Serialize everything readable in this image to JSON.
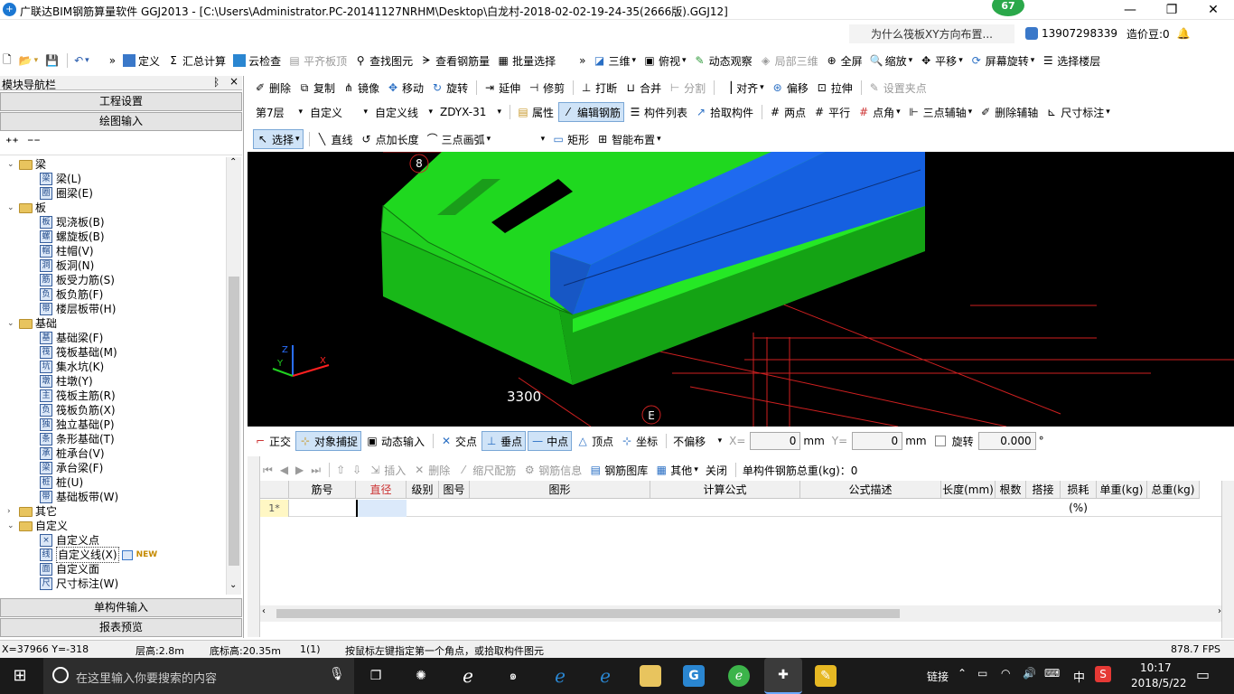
{
  "window": {
    "title": "广联达BIM钢筋算量软件 GGJ2013 - [C:\\Users\\Administrator.PC-20141127NRHM\\Desktop\\白龙村-2018-02-02-19-24-35(2666版).GGJ12]",
    "badge": "67",
    "min": "—",
    "max": "❐",
    "close": "✕"
  },
  "menu_right": {
    "question": "为什么筏板XY方向布置...",
    "phone": "13907298339",
    "coins": "造价豆:0"
  },
  "toolbar1": {
    "items": [
      "定义",
      "汇总计算",
      "云检查",
      "平齐板顶",
      "查找图元",
      "查看钢筋量",
      "批量选择",
      "三维",
      "俯视",
      "动态观察",
      "局部三维",
      "全屏",
      "缩放",
      "平移",
      "屏幕旋转",
      "选择楼层"
    ]
  },
  "panel": {
    "title": "模块导航栏",
    "pin": "ᛒ",
    "close": "×",
    "btn_project": "工程设置",
    "btn_drawing": "绘图输入",
    "btn_single": "单构件输入",
    "btn_report": "报表预览"
  },
  "tree": [
    {
      "type": "folder",
      "label": "梁",
      "toggle": "⌄"
    },
    {
      "type": "leaf",
      "label": "梁(L)",
      "icon": "梁"
    },
    {
      "type": "leaf",
      "label": "圈梁(E)",
      "icon": "圈"
    },
    {
      "type": "folder",
      "label": "板",
      "toggle": "⌄"
    },
    {
      "type": "leaf",
      "label": "现浇板(B)",
      "icon": "板"
    },
    {
      "type": "leaf",
      "label": "螺旋板(B)",
      "icon": "螺"
    },
    {
      "type": "leaf",
      "label": "柱帽(V)",
      "icon": "帽"
    },
    {
      "type": "leaf",
      "label": "板洞(N)",
      "icon": "洞"
    },
    {
      "type": "leaf",
      "label": "板受力筋(S)",
      "icon": "筋"
    },
    {
      "type": "leaf",
      "label": "板负筋(F)",
      "icon": "负"
    },
    {
      "type": "leaf",
      "label": "楼层板带(H)",
      "icon": "带"
    },
    {
      "type": "folder",
      "label": "基础",
      "toggle": "⌄"
    },
    {
      "type": "leaf",
      "label": "基础梁(F)",
      "icon": "基"
    },
    {
      "type": "leaf",
      "label": "筏板基础(M)",
      "icon": "筏"
    },
    {
      "type": "leaf",
      "label": "集水坑(K)",
      "icon": "坑"
    },
    {
      "type": "leaf",
      "label": "柱墩(Y)",
      "icon": "墩"
    },
    {
      "type": "leaf",
      "label": "筏板主筋(R)",
      "icon": "主"
    },
    {
      "type": "leaf",
      "label": "筏板负筋(X)",
      "icon": "负"
    },
    {
      "type": "leaf",
      "label": "独立基础(P)",
      "icon": "独"
    },
    {
      "type": "leaf",
      "label": "条形基础(T)",
      "icon": "条"
    },
    {
      "type": "leaf",
      "label": "桩承台(V)",
      "icon": "承"
    },
    {
      "type": "leaf",
      "label": "承台梁(F)",
      "icon": "梁"
    },
    {
      "type": "leaf",
      "label": "桩(U)",
      "icon": "桩"
    },
    {
      "type": "leaf",
      "label": "基础板带(W)",
      "icon": "带"
    },
    {
      "type": "folder",
      "label": "其它",
      "toggle": "›"
    },
    {
      "type": "folder",
      "label": "自定义",
      "toggle": "⌄"
    },
    {
      "type": "leaf",
      "label": "自定义点",
      "icon": "×"
    },
    {
      "type": "leaf",
      "label": "自定义线(X)",
      "icon": "线",
      "badge": "NEW",
      "selected": true
    },
    {
      "type": "leaf",
      "label": "自定义面",
      "icon": "面"
    },
    {
      "type": "leaf",
      "label": "尺寸标注(W)",
      "icon": "尺"
    }
  ],
  "toolbar2": {
    "items": [
      "删除",
      "复制",
      "镜像",
      "移动",
      "旋转",
      "延伸",
      "修剪",
      "打断",
      "合并",
      "分割",
      "对齐",
      "偏移",
      "拉伸",
      "设置夹点"
    ]
  },
  "toolbar3": {
    "floor": "第7层",
    "type": "自定义",
    "subtype": "自定义线",
    "component": "ZDYX-31",
    "items": [
      "属性",
      "编辑钢筋",
      "构件列表",
      "拾取构件",
      "两点",
      "平行",
      "点角",
      "三点辅轴",
      "删除辅轴",
      "尺寸标注"
    ]
  },
  "toolbar4": {
    "items": [
      "选择",
      "直线",
      "点加长度",
      "三点画弧",
      "矩形",
      "智能布置"
    ]
  },
  "viewport": {
    "axis_8": "8",
    "axis_e": "E",
    "dimension": "3300"
  },
  "snapbar": {
    "items": [
      "正交",
      "对象捕捉",
      "动态输入",
      "交点",
      "垂点",
      "中点",
      "顶点",
      "坐标"
    ],
    "offset_mode": "不偏移",
    "x_label": "X=",
    "x_value": "0",
    "y_label": "Y=",
    "y_value": "0",
    "unit": "mm",
    "rotate_label": "旋转",
    "rotate_value": "0.000",
    "degree": "°"
  },
  "rebar_toolbar": {
    "items": [
      "插入",
      "删除",
      "缩尺配筋",
      "钢筋信息",
      "钢筋图库",
      "其他",
      "关闭"
    ],
    "total_weight": "单构件钢筋总重(kg)：0"
  },
  "grid": {
    "columns": [
      "筋号",
      "直径(mm)",
      "级别",
      "图号",
      "图形",
      "计算公式",
      "公式描述",
      "长度(mm)",
      "根数",
      "搭接",
      "损耗(%)",
      "单重(kg)",
      "总重(kg)"
    ],
    "row1": "1*"
  },
  "status": {
    "coords": "X=37966 Y=-318",
    "floor_height": "层高:2.8m",
    "base_height": "底标高:20.35m",
    "count": "1(1)",
    "hint": "按鼠标左键指定第一个角点，或拾取构件图元",
    "fps": "878.7 FPS"
  },
  "taskbar": {
    "search": "在这里输入你要搜索的内容",
    "link": "链接",
    "ime": "中",
    "time": "10:17",
    "date": "2018/5/22"
  },
  "colors": {
    "slab_green": "#1ed61e",
    "beam_blue": "#1a64e6",
    "grid_red": "#d02020"
  }
}
